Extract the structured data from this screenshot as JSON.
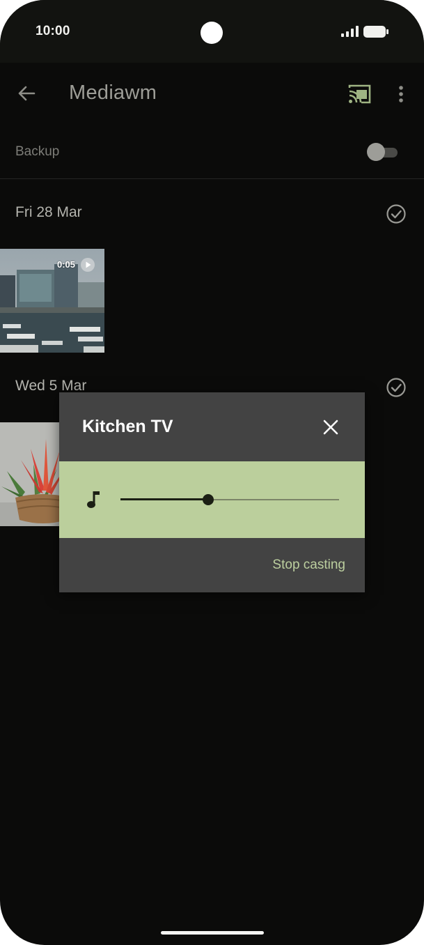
{
  "status_bar": {
    "time": "10:00"
  },
  "app_bar": {
    "title": "Mediawm"
  },
  "backup": {
    "label": "Backup",
    "enabled": false
  },
  "sections": [
    {
      "date": "Fri 28 Mar",
      "items": [
        {
          "type": "video",
          "duration": "0:05"
        }
      ]
    },
    {
      "date": "Wed 5 Mar",
      "items": [
        {
          "type": "photo"
        }
      ]
    }
  ],
  "cast_dialog": {
    "title": "Kitchen TV",
    "volume": 0.4,
    "stop_label": "Stop casting"
  },
  "colors": {
    "background": "#0b0b0a",
    "accent": "#bccf9f",
    "dialog": "#434343",
    "volume_panel": "#bbcf9c"
  },
  "icons": [
    "back-arrow-icon",
    "cast-icon",
    "more-vert-icon",
    "check-circle-icon",
    "play-icon",
    "close-icon",
    "music-note-icon"
  ]
}
